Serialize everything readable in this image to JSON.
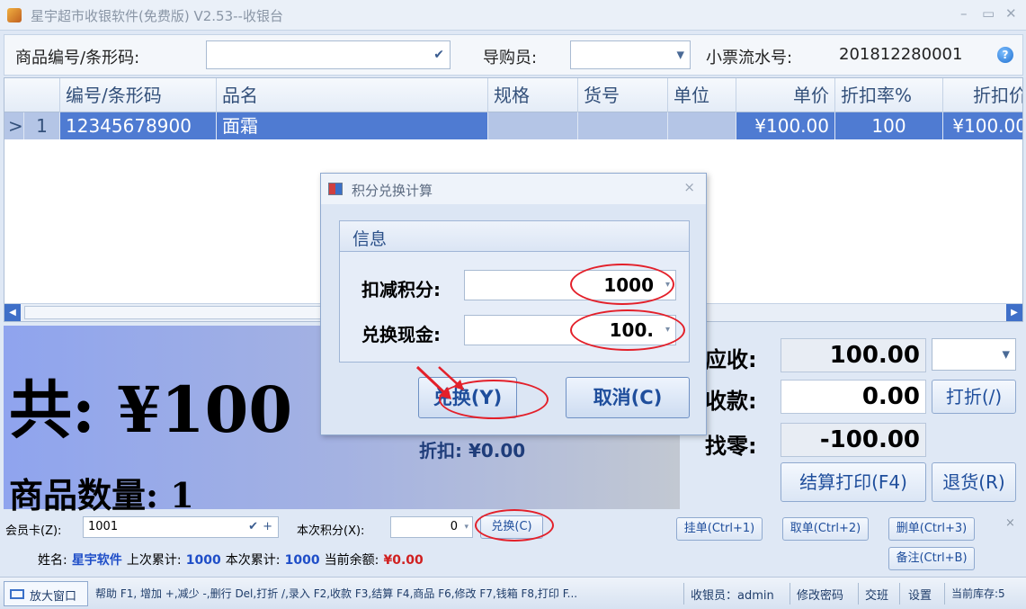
{
  "window": {
    "title": "星宇超市收银软件(免费版) V2.53--收银台",
    "controls": [
      "–",
      "▭",
      "✕"
    ]
  },
  "toprow": {
    "barcode_label": "商品编号/条形码:",
    "barcode_value": "",
    "guide_label": "导购员:",
    "guide_value": "",
    "ticket_label": "小票流水号:",
    "ticket_value": "201812280001"
  },
  "grid": {
    "columns": [
      "编号/条形码",
      "品名",
      "规格",
      "货号",
      "单位",
      "单价",
      "折扣率%",
      "折扣价"
    ],
    "rows": [
      {
        "marker": ">",
        "index": "1",
        "code": "12345678900",
        "name": "面霜",
        "spec": "",
        "item_no": "",
        "unit": "",
        "price": "¥100.00",
        "rate": "100",
        "disc_price": "¥100.00"
      }
    ]
  },
  "summary": {
    "total": "共: ¥100",
    "discount": "折扣: ¥0.00",
    "quantity": "商品数量: 1"
  },
  "payment": {
    "due_label": "应收:",
    "due_value": "100.00",
    "paid_label": "收款:",
    "paid_value": "0.00",
    "change_label": "找零:",
    "change_value": "-100.00",
    "discount_btn": "打折(/)",
    "checkout_btn": "结算打印(F4)",
    "return_btn": "退货(R)"
  },
  "member": {
    "card_label": "会员卡(Z):",
    "card_value": "1001",
    "points_label": "本次积分(X):",
    "points_value": "0",
    "exchange_btn": "兑换(C)",
    "hold_btn": "挂单(Ctrl+1)",
    "retrieve_btn": "取单(Ctrl+2)",
    "delete_btn": "删单(Ctrl+3)",
    "note_btn": "备注(Ctrl+B)",
    "close": "×",
    "name_label": "姓名:",
    "name_value": "星宇软件",
    "prev_label": "上次累计:",
    "prev_value": "1000",
    "cur_label": "本次累计:",
    "cur_value": "1000",
    "balance_label": "当前余额:",
    "balance_value": "¥0.00"
  },
  "statusbar": {
    "maximize": "放大窗口",
    "help": "帮助 F1, 增加 +,减少 -,删行 Del,打折 /,录入 F2,收款 F3,结算 F4,商品 F6,修改 F7,钱箱 F8,打印 F...",
    "cashier": "收银员：admin",
    "change_pwd": "修改密码",
    "shift": "交班",
    "settings": "设置",
    "stock": "当前库存:5"
  },
  "dialog": {
    "title": "积分兑换计算",
    "close": "×",
    "group_title": "信息",
    "deduct_label": "扣减积分:",
    "deduct_value": "1000",
    "cash_label": "兑换现金:",
    "cash_value": "100.",
    "exchange_btn": "兑换(Y)",
    "cancel_btn": "取消(C)"
  },
  "colors": {
    "accent": "#4f7bd2",
    "highlight_ring": "#e3202a",
    "summary_gradient_start": "#8fa4ee"
  }
}
